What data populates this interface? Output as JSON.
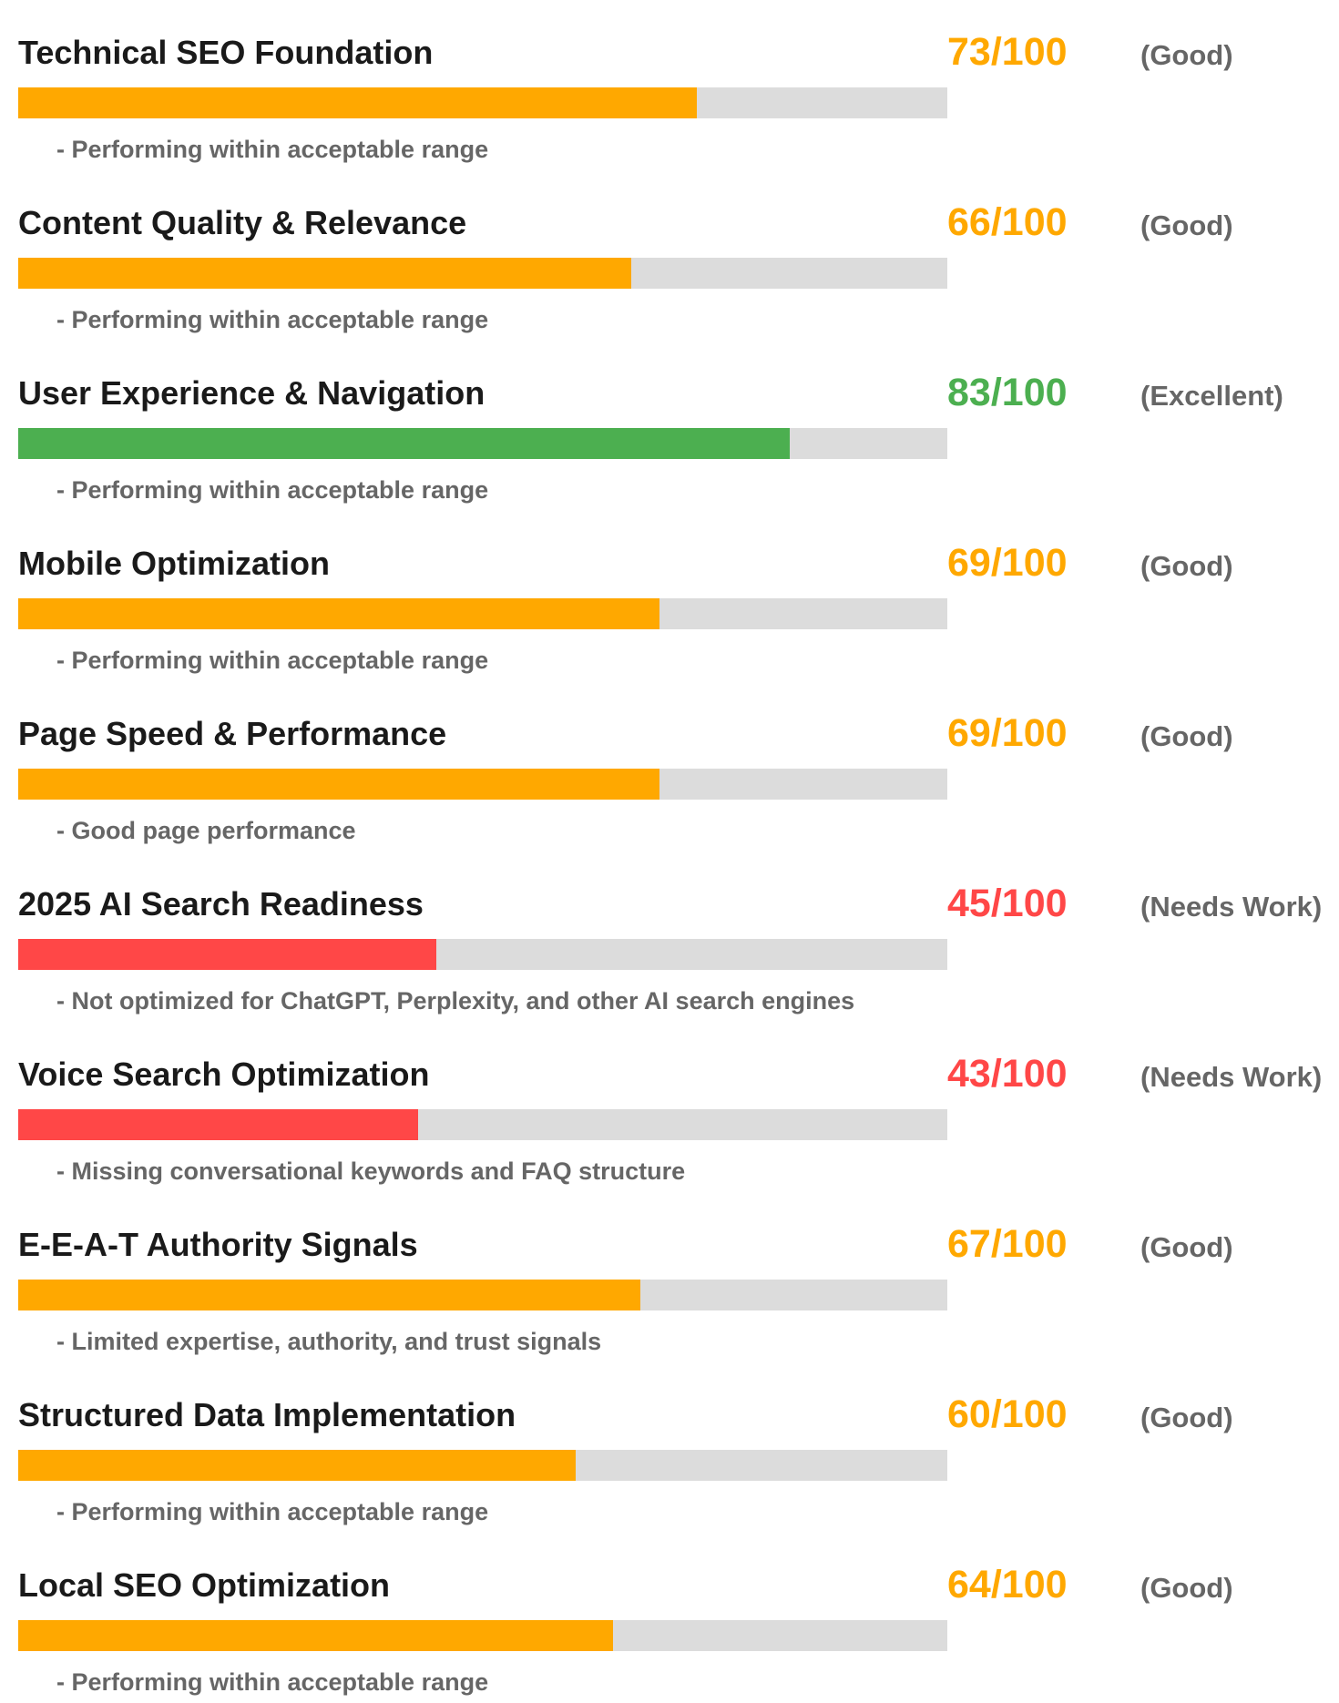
{
  "colors": {
    "good": "#FFA800",
    "excellent": "#4CAF50",
    "needs_work": "#FF4747",
    "track": "#DCDCDC"
  },
  "items": [
    {
      "name": "Technical SEO Foundation",
      "score": 73,
      "score_text": "73/100",
      "rating": "(Good)",
      "status": "good",
      "note": "- Performing within acceptable range"
    },
    {
      "name": "Content Quality & Relevance",
      "score": 66,
      "score_text": "66/100",
      "rating": "(Good)",
      "status": "good",
      "note": "- Performing within acceptable range"
    },
    {
      "name": "User Experience & Navigation",
      "score": 83,
      "score_text": "83/100",
      "rating": "(Excellent)",
      "status": "excellent",
      "note": "- Performing within acceptable range"
    },
    {
      "name": "Mobile Optimization",
      "score": 69,
      "score_text": "69/100",
      "rating": "(Good)",
      "status": "good",
      "note": "- Performing within acceptable range"
    },
    {
      "name": "Page Speed & Performance",
      "score": 69,
      "score_text": "69/100",
      "rating": "(Good)",
      "status": "good",
      "note": "- Good page performance"
    },
    {
      "name": "2025 AI Search Readiness",
      "score": 45,
      "score_text": "45/100",
      "rating": "(Needs Work)",
      "status": "needs_work",
      "note": "- Not optimized for ChatGPT, Perplexity, and other AI search engines"
    },
    {
      "name": "Voice Search Optimization",
      "score": 43,
      "score_text": "43/100",
      "rating": "(Needs Work)",
      "status": "needs_work",
      "note": "- Missing conversational keywords and FAQ structure"
    },
    {
      "name": "E-E-A-T Authority Signals",
      "score": 67,
      "score_text": "67/100",
      "rating": "(Good)",
      "status": "good",
      "note": "- Limited expertise, authority, and trust signals"
    },
    {
      "name": "Structured Data Implementation",
      "score": 60,
      "score_text": "60/100",
      "rating": "(Good)",
      "status": "good",
      "note": "- Performing within acceptable range"
    },
    {
      "name": "Local SEO Optimization",
      "score": 64,
      "score_text": "64/100",
      "rating": "(Good)",
      "status": "good",
      "note": "- Performing within acceptable range"
    }
  ]
}
